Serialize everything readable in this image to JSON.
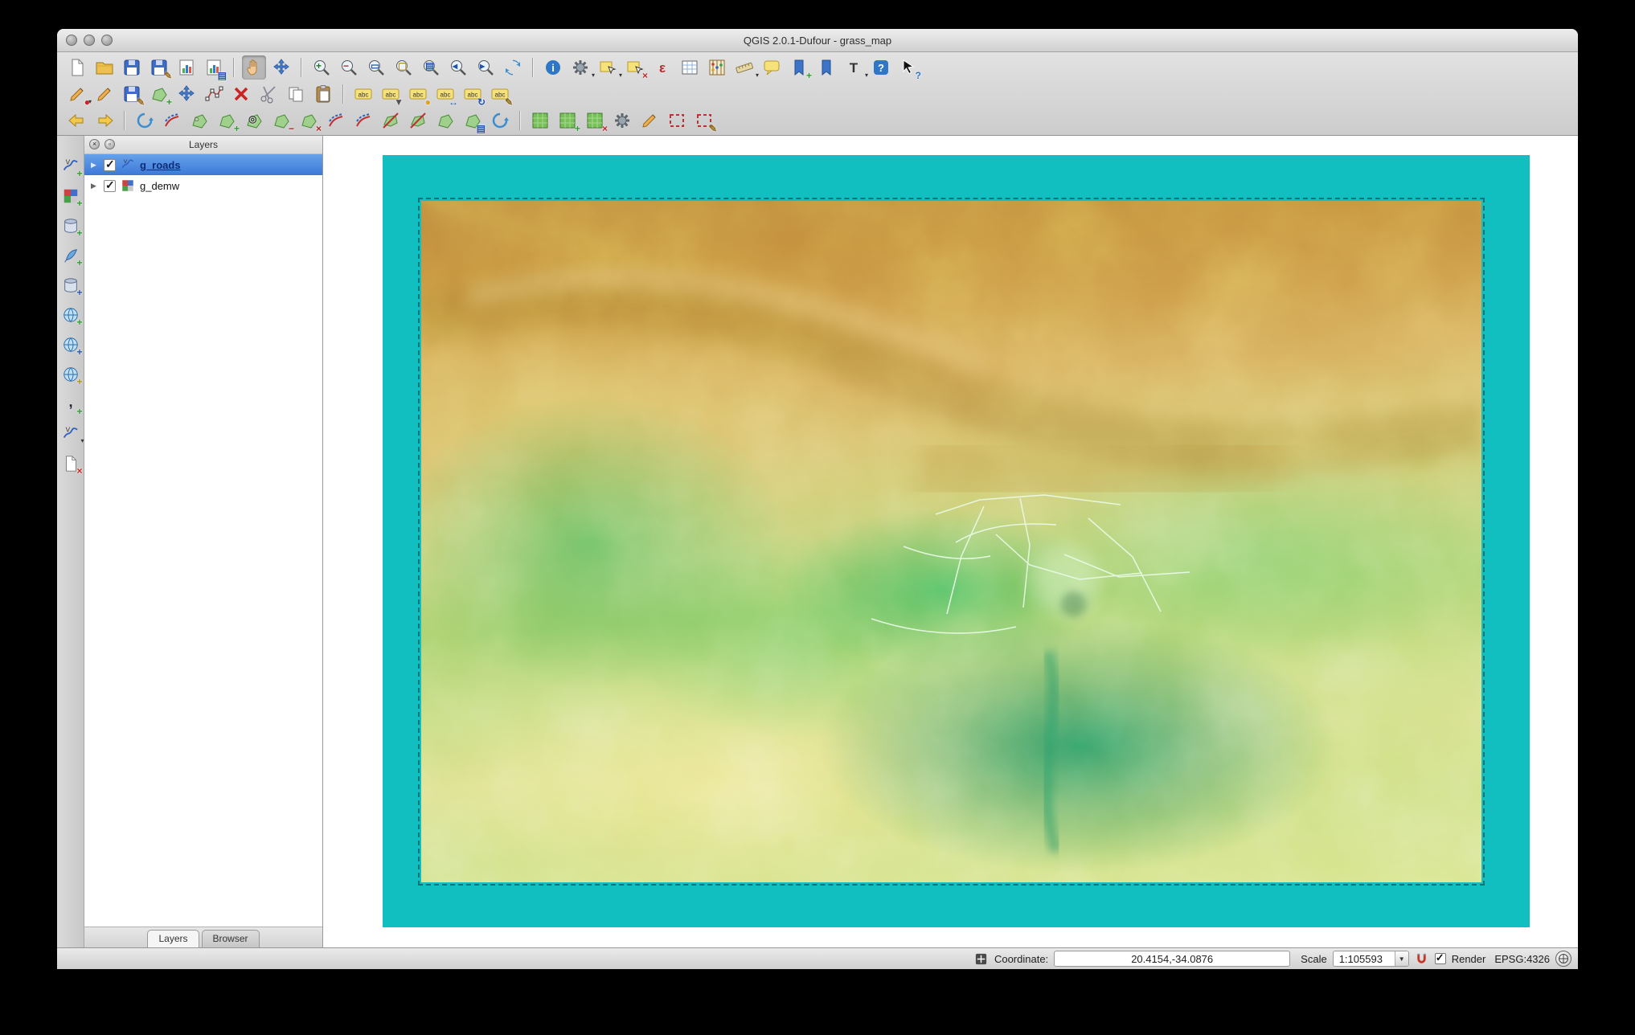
{
  "window": {
    "title": "QGIS 2.0.1-Dufour - grass_map"
  },
  "toolbars": {
    "row1": [
      {
        "name": "new-project",
        "sym": "page"
      },
      {
        "name": "open-project",
        "sym": "folder"
      },
      {
        "name": "save-project",
        "sym": "disk"
      },
      {
        "name": "save-project-as",
        "sym": "disk",
        "ov": "✎",
        "ovc": "#9a6a18"
      },
      {
        "name": "new-print-composer",
        "sym": "chart"
      },
      {
        "name": "composer-manager",
        "sym": "chart",
        "ov": "▤",
        "ovc": "#2255aa"
      },
      {
        "sep": true
      },
      {
        "name": "pan-map",
        "sym": "hand",
        "active": true
      },
      {
        "name": "pan-map-to-selection",
        "sym": "move"
      },
      {
        "sep": true
      },
      {
        "name": "zoom-in",
        "sym": "zoom",
        "ov": "+",
        "op": "c",
        "ovc": "#1a7a1a"
      },
      {
        "name": "zoom-out",
        "sym": "zoom",
        "ov": "−",
        "op": "c",
        "ovc": "#aa2222"
      },
      {
        "name": "zoom-full-extent",
        "sym": "zoom",
        "ov": "▭",
        "op": "c",
        "ovc": "#2255aa"
      },
      {
        "name": "zoom-to-selection",
        "sym": "zoom",
        "ov": "▢",
        "op": "c",
        "ovc": "#b09020"
      },
      {
        "name": "zoom-to-layer",
        "sym": "zoom",
        "ov": "▤",
        "op": "c",
        "ovc": "#2255aa"
      },
      {
        "name": "zoom-last",
        "sym": "zoom",
        "ov": "◂",
        "op": "c",
        "ovc": "#2255aa"
      },
      {
        "name": "zoom-next",
        "sym": "zoom",
        "ov": "▸",
        "op": "c",
        "ovc": "#2255aa"
      },
      {
        "name": "refresh-map",
        "sym": "refresh"
      },
      {
        "sep": true
      },
      {
        "name": "identify-features",
        "sym": "info"
      },
      {
        "name": "run-feature-action",
        "sym": "gear",
        "dd": true
      },
      {
        "name": "select-features",
        "sym": "select",
        "dd": true
      },
      {
        "name": "deselect-features",
        "sym": "select",
        "ov": "×",
        "ovc": "#cc2222"
      },
      {
        "name": "select-by-expression",
        "sym": "eps"
      },
      {
        "name": "open-attribute-table",
        "sym": "table"
      },
      {
        "name": "field-calculator",
        "sym": "abacus"
      },
      {
        "name": "measure-line",
        "sym": "ruler",
        "dd": true
      },
      {
        "name": "map-tips",
        "sym": "balloon"
      },
      {
        "name": "new-bookmark",
        "sym": "bookmark",
        "ov": "+"
      },
      {
        "name": "show-bookmarks",
        "sym": "bookmark"
      },
      {
        "name": "text-annotation",
        "sym": "T",
        "dd": true
      },
      {
        "name": "help",
        "sym": "help"
      },
      {
        "name": "whats-this",
        "sym": "cursor",
        "ov": "?",
        "ovc": "#2f76c6"
      }
    ],
    "row2": [
      {
        "name": "current-edits",
        "sym": "pencil",
        "ov": "●",
        "ovc": "#cc2222",
        "dd": true
      },
      {
        "name": "toggle-editing",
        "sym": "pencil"
      },
      {
        "name": "save-layer-edits",
        "sym": "disk",
        "ov": "✎",
        "ovc": "#9a6a18"
      },
      {
        "name": "add-feature",
        "sym": "poly",
        "ov": "+"
      },
      {
        "name": "move-feature",
        "sym": "move"
      },
      {
        "name": "node-tool",
        "sym": "node"
      },
      {
        "name": "delete-selected",
        "sym": "x"
      },
      {
        "name": "cut-features",
        "sym": "scissors"
      },
      {
        "name": "copy-features",
        "sym": "copy"
      },
      {
        "name": "paste-features",
        "sym": "paste"
      },
      {
        "sep": true
      },
      {
        "name": "layer-labeling-options",
        "sym": "abc"
      },
      {
        "name": "pin-unpin-labels",
        "sym": "abc",
        "ov": "▼",
        "ovc": "#555555"
      },
      {
        "name": "highlight-pinned-labels",
        "sym": "abc",
        "ov": "●",
        "ovc": "#e0a020"
      },
      {
        "name": "move-label",
        "sym": "abc",
        "ov": "↔",
        "ovc": "#2255aa"
      },
      {
        "name": "rotate-label",
        "sym": "abc",
        "ov": "↻",
        "ovc": "#2255aa"
      },
      {
        "name": "change-label-properties",
        "sym": "abc",
        "ov": "✎",
        "ovc": "#8a6a18"
      }
    ],
    "row3": [
      {
        "name": "undo",
        "sym": "arrowl"
      },
      {
        "name": "redo",
        "sym": "arrowr"
      },
      {
        "sep": true
      },
      {
        "name": "rotate-feature",
        "sym": "rotate"
      },
      {
        "name": "simplify-feature",
        "sym": "offset"
      },
      {
        "name": "add-ring",
        "sym": "poly",
        "ov": "○",
        "op": "c",
        "ovc": "#333333"
      },
      {
        "name": "add-part",
        "sym": "poly",
        "ov": "+"
      },
      {
        "name": "fill-ring",
        "sym": "poly",
        "ov": "◎",
        "op": "c",
        "ovc": "#333333"
      },
      {
        "name": "delete-ring",
        "sym": "poly",
        "ov": "−",
        "ovc": "#aa2222"
      },
      {
        "name": "delete-part",
        "sym": "poly",
        "ov": "×",
        "ovc": "#aa2222"
      },
      {
        "name": "reshape-features",
        "sym": "offset"
      },
      {
        "name": "offset-curve",
        "sym": "offset"
      },
      {
        "name": "split-features",
        "sym": "split"
      },
      {
        "name": "split-parts",
        "sym": "split"
      },
      {
        "name": "merge-selected-features",
        "sym": "poly"
      },
      {
        "name": "merge-feature-attributes",
        "sym": "poly",
        "ov": "▤",
        "ovc": "#2255aa"
      },
      {
        "name": "rotate-point-symbols",
        "sym": "rotate"
      },
      {
        "sep": true
      },
      {
        "name": "grass-open-mapset",
        "sym": "grass"
      },
      {
        "name": "grass-new-mapset",
        "sym": "grass",
        "ov": "+"
      },
      {
        "name": "grass-close-mapset",
        "sym": "grass",
        "ov": "×",
        "ovc": "#cc2222"
      },
      {
        "name": "grass-tools",
        "sym": "gear"
      },
      {
        "name": "grass-edit-vector",
        "sym": "pencil"
      },
      {
        "name": "grass-display-region",
        "sym": "region"
      },
      {
        "name": "grass-edit-region",
        "sym": "region",
        "ov": "✎",
        "ovc": "#8a6a18"
      }
    ],
    "left": [
      {
        "name": "add-vector-layer",
        "sym": "vlayer",
        "ov": "+"
      },
      {
        "name": "add-raster-layer",
        "sym": "raster",
        "ov": "+"
      },
      {
        "name": "add-postgis-layer",
        "sym": "db",
        "ov": "+"
      },
      {
        "name": "add-spatialite-layer",
        "sym": "quill",
        "ov": "+"
      },
      {
        "name": "add-mssql-layer",
        "sym": "db",
        "ov": "+",
        "ovc": "#2255aa"
      },
      {
        "name": "add-wms-layer",
        "sym": "globe",
        "ov": "+"
      },
      {
        "name": "add-wcs-layer",
        "sym": "globe",
        "ov": "+",
        "ovc": "#2255aa"
      },
      {
        "name": "add-wfs-layer",
        "sym": "globe",
        "ov": "+",
        "ovc": "#b09020"
      },
      {
        "name": "add-delimited-text-layer",
        "sym": "comma",
        "ov": "+"
      },
      {
        "name": "new-shapefile-layer",
        "sym": "vlayer",
        "dd": true
      },
      {
        "name": "remove-layer",
        "sym": "page",
        "ov": "×",
        "ovc": "#cc2222"
      }
    ]
  },
  "layers_panel": {
    "title": "Layers",
    "items": [
      {
        "name": "g_roads",
        "class": "selected type-vector",
        "checked": true
      },
      {
        "name": "g_demw",
        "class": "type-raster",
        "checked": true
      }
    ],
    "tabs": [
      {
        "label": "Layers",
        "class": "active"
      },
      {
        "label": "Browser",
        "class": ""
      }
    ]
  },
  "map": {
    "region_color": "#12bfc0",
    "dem_palette": [
      "#bf8c3e",
      "#d6af5c",
      "#d2cc74",
      "#a8d06c",
      "#46b95f",
      "#dde292",
      "#229460"
    ]
  },
  "status_bar": {
    "coordinate_label": "Coordinate:",
    "coordinate_value": "20.4154,-34.0876",
    "scale_label": "Scale",
    "scale_value": "1:105593",
    "render_label": "Render",
    "render_checked": true,
    "crs_label": "EPSG:4326"
  }
}
